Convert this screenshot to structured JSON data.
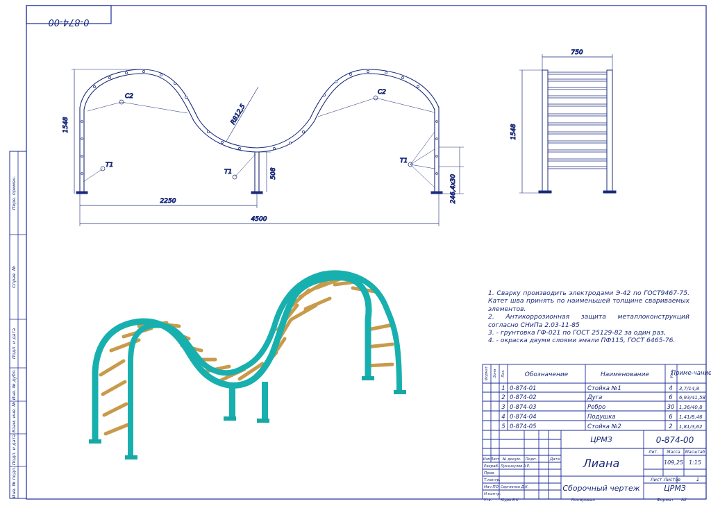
{
  "header": {
    "doc_number_rotated": "0-874-00"
  },
  "side_strip": {
    "labels": [
      "Перв. примен.",
      "Справ. №",
      "Подп. и дата",
      "Инв. № дубл.",
      "Взам. инв. №",
      "Подп. и дата",
      "Инв. № подл."
    ]
  },
  "drawing": {
    "dims": {
      "height_left": "1548",
      "width_total": "4500",
      "width_half": "2250",
      "radius": "R812,5",
      "mid_height": "508",
      "pad": "246,4x30",
      "side_width": "750",
      "side_height": "1548"
    },
    "callouts": {
      "c2": "С2",
      "t1": "Т1"
    }
  },
  "notes": [
    "1. Сварку производить электродами Э-42 по ГОСТ9467-75. Катет шва принять по наименьшей толщине свариваемых элементов.",
    "2. Антикоррозионная защита металлоконструкций согласно СНиПа 2.03-11-85",
    "3.    - грунтовка ГФ-021 по ГОСТ 25129-82 за один раз,",
    "4.    - окраска двумя слоями эмали ПФ115, ГОСТ 6465-76."
  ],
  "spec": {
    "headers": {
      "format": "Формат",
      "zone": "Зона",
      "pos": "Поз.",
      "designation": "Обозначение",
      "name": "Наименование",
      "qty": "Кол.",
      "note": "Приме-чание"
    },
    "rows": [
      {
        "pos": "1",
        "designation": "0-874-01",
        "name": "Стойка №1",
        "qty": "4",
        "note": "3,7/14,8"
      },
      {
        "pos": "2",
        "designation": "0-874-02",
        "name": "Дуга",
        "qty": "6",
        "note": "6,93/41,58"
      },
      {
        "pos": "3",
        "designation": "0-874-03",
        "name": "Ребро",
        "qty": "30",
        "note": "1,36/40,8"
      },
      {
        "pos": "4",
        "designation": "0-874-04",
        "name": "Подушка",
        "qty": "6",
        "note": "1,41/8,46"
      },
      {
        "pos": "5",
        "designation": "0-874-05",
        "name": "Стойка №2",
        "qty": "2",
        "note": "1,81/3,62"
      }
    ]
  },
  "title_block": {
    "org_top": "ЦРМЗ",
    "doc_number": "0-874-00",
    "title": "Лиана",
    "subtitle": "Сборочный чертеж",
    "org": "ЦРМЗ",
    "col_headers": {
      "izm": "Изм",
      "list": "Лист",
      "doc": "№ докум.",
      "sign": "Подп.",
      "date": "Дата"
    },
    "roles": {
      "razrab": "Разраб.",
      "prov": "Пров.",
      "tkontr": "Т.контр.",
      "nach": "Нач.ПО",
      "nkontr": "Н.контр.",
      "utv": "Утв."
    },
    "people": {
      "razrab": "Луканкулов А.Р.",
      "nach": "Сергиенко Д.К.",
      "utv": "Юдин В.К."
    },
    "lit_label": "Лит.",
    "mass_label": "Масса",
    "scale_label": "Масштаб",
    "mass": "109,25",
    "scale": "1:15",
    "sheet_label": "Лист",
    "sheets_label": "Листов",
    "sheets": "1",
    "copied": "Копировал",
    "format_label": "Формат",
    "format": "А2"
  },
  "colors": {
    "ink": "#1a2a7a",
    "frame": "#1a2a9a",
    "teal": "#18b0ae",
    "wood": "#e8c27a"
  }
}
